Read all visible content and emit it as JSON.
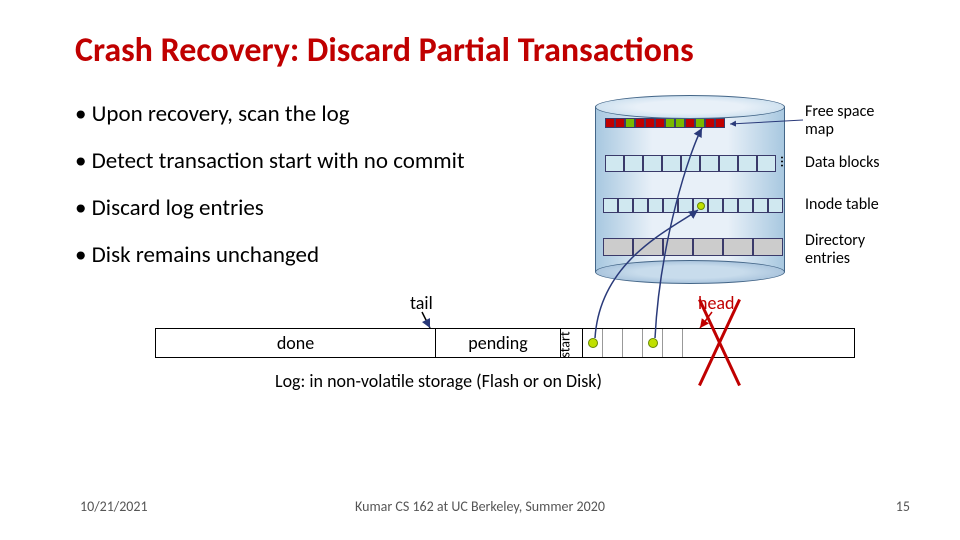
{
  "title": "Crash Recovery: Discard Partial Transactions",
  "bullets": {
    "b1": "• Upon recovery, scan the log",
    "b2": "• Detect transaction start with no commit",
    "b3": "• Discard log entries",
    "b4": "• Disk remains unchanged"
  },
  "disk_labels": {
    "free_space_map": "Free space\nmap",
    "data_blocks": "Data blocks",
    "inode_table": "Inode table",
    "directory_entries": "Directory\nentries"
  },
  "free_space_cells": [
    "r",
    "r",
    "g",
    "r",
    "r",
    "r",
    "g",
    "g",
    "r",
    "g",
    "r",
    "r"
  ],
  "log": {
    "tail": "tail",
    "head": "head",
    "done": "done",
    "pending": "pending",
    "start": "start",
    "caption": "Log: in non-volatile storage (Flash or on Disk)"
  },
  "footer": {
    "date": "10/21/2021",
    "center": "Kumar CS 162 at UC Berkeley, Summer 2020",
    "page": "15"
  }
}
